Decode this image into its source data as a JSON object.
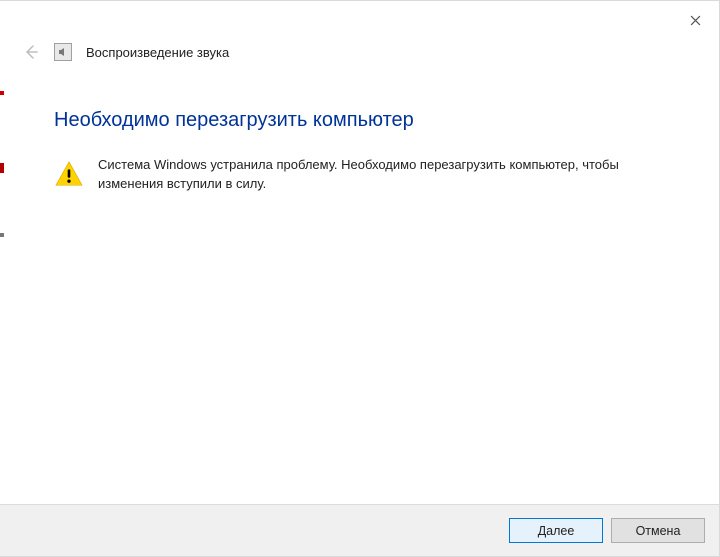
{
  "window": {
    "title": "Воспроизведение звука"
  },
  "main": {
    "heading": "Необходимо перезагрузить компьютер",
    "message": "Система Windows устранила проблему. Необходимо перезагрузить компьютер, чтобы изменения вступили в силу."
  },
  "footer": {
    "next_label": "Далее",
    "cancel_label": "Отмена"
  }
}
